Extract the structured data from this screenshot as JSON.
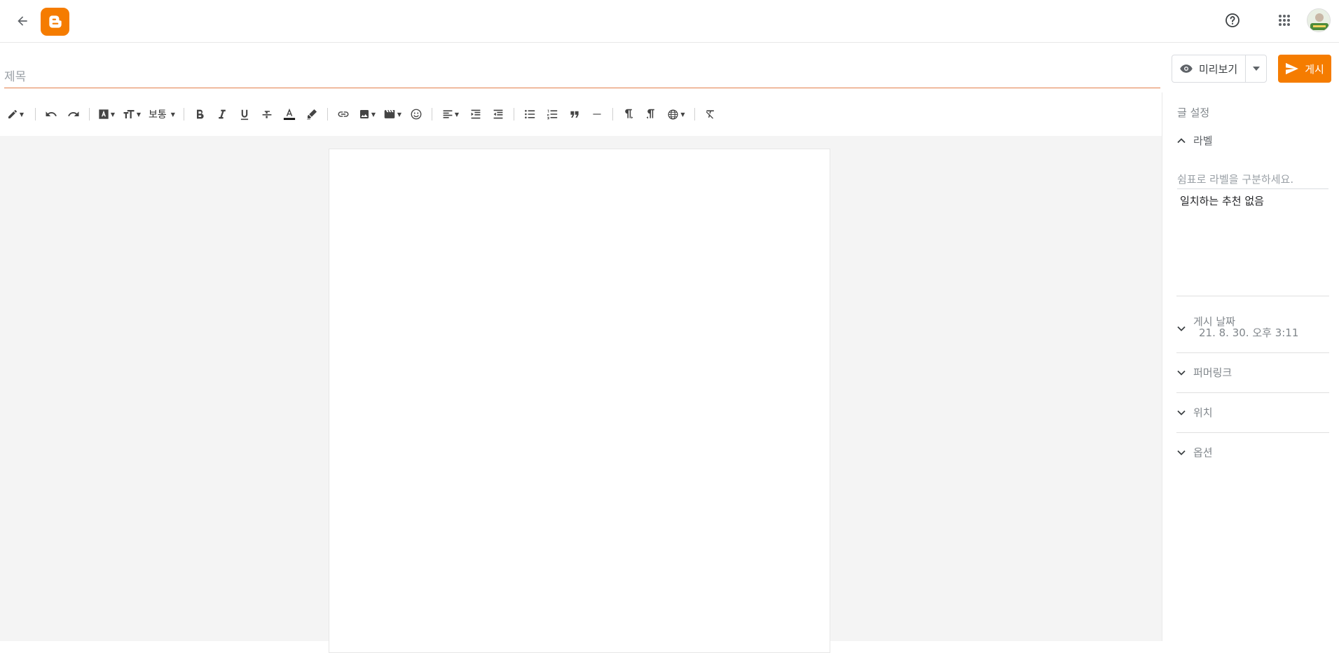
{
  "header": {
    "back_icon": "arrow-left-icon",
    "logo_icon": "blogger-logo-icon",
    "help_icon": "help-circle-icon",
    "apps_icon": "apps-grid-icon",
    "avatar_icon": "user-avatar",
    "brand_color": "#f57c00"
  },
  "title": {
    "placeholder": "제목",
    "value": ""
  },
  "actions": {
    "preview_label": "미리보기",
    "publish_label": "게시"
  },
  "toolbar": {
    "paragraph_style_label": "보통"
  },
  "settings": {
    "title": "글 설정",
    "labels": {
      "heading": "라벨",
      "placeholder": "쉼표로 라벨을 구분하세요.",
      "no_suggestions": "일치하는 추천 없음"
    },
    "publish_date": {
      "heading": "게시 날짜",
      "value": "21. 8. 30. 오후 3:11"
    },
    "permalink": {
      "heading": "퍼머링크"
    },
    "location": {
      "heading": "위치"
    },
    "options": {
      "heading": "옵션"
    }
  }
}
